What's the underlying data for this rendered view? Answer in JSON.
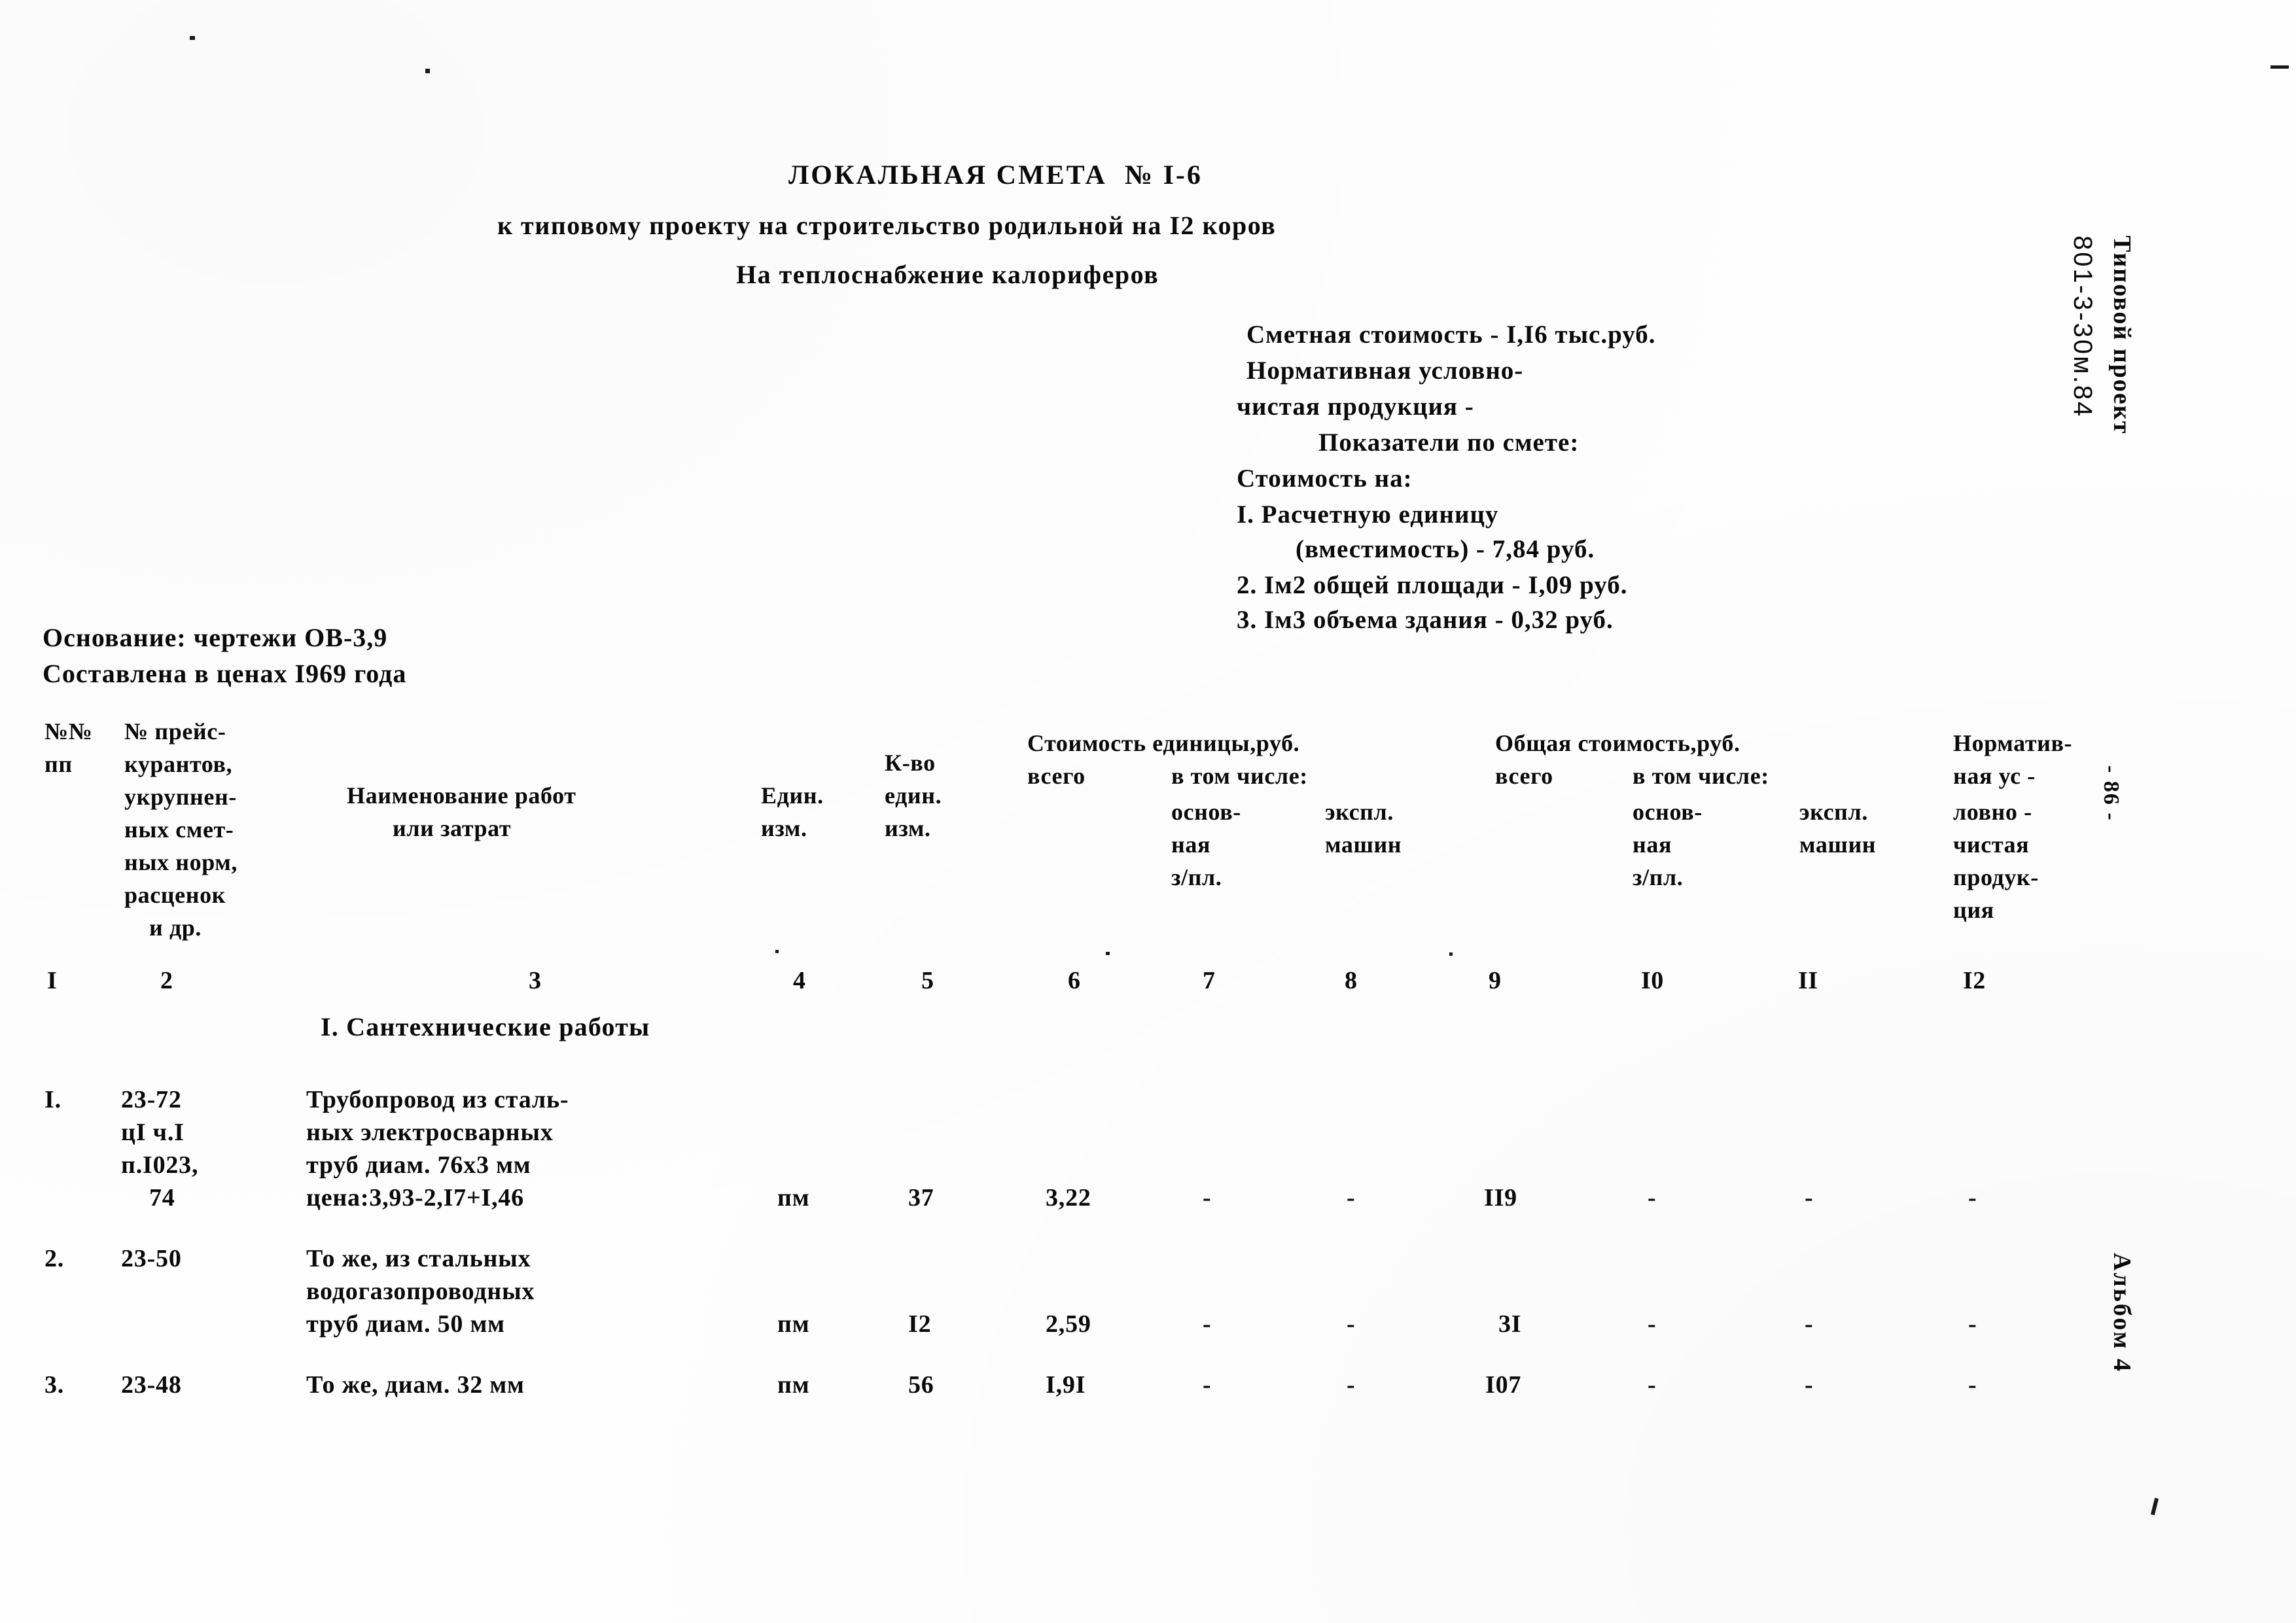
{
  "document": {
    "title": "ЛОКАЛЬНАЯ СМЕТА  № I-6",
    "subtitle_1": "к типовому проекту на строительство родильной на I2 коров",
    "subtitle_2": "На теплоснабжение калориферов"
  },
  "summary": {
    "lines": [
      "Сметная стоимость - I,I6 тыс.руб.",
      "Нормативная условно-",
      "чистая продукция -",
      "Показатели по смете:",
      "Стоимость на:",
      "I. Расчетную единицу",
      "(вместимость) - 7,84 руб.",
      "2. Iм2 общей площади - I,09 руб.",
      "3. Iм3 объема здания - 0,32 руб."
    ]
  },
  "basis": {
    "line_1": "Основание: чертежи ОВ-3,9",
    "line_2": "Составлена в ценах I969 года"
  },
  "table": {
    "header": {
      "col1": [
        "№№",
        "пп"
      ],
      "col2": [
        "№ прейс-",
        "курантов,",
        "укрупнен-",
        "ных смет-",
        "ных норм,",
        "расценок",
        "и др."
      ],
      "col3": [
        "Наименование работ",
        "или затрат"
      ],
      "col4": [
        "Един.",
        "изм."
      ],
      "col5": [
        "К-во",
        "един.",
        "изм."
      ],
      "group_unit_cost": "Стоимость единицы,руб.",
      "col6": [
        "всего"
      ],
      "sub_unit": "в том числе:",
      "col7": [
        "основ-",
        "ная",
        "з/пл."
      ],
      "col8": [
        "экспл.",
        "машин"
      ],
      "group_total_cost": "Общая стоимость,руб.",
      "col9": [
        "всего"
      ],
      "sub_total": "в том числе:",
      "col10": [
        "основ-",
        "ная",
        "з/пл."
      ],
      "col11": [
        "экспл.",
        "машин"
      ],
      "col12": [
        "Норматив-",
        "ная ус -",
        "ловно -",
        "чистая",
        "продук-",
        "ция"
      ]
    },
    "column_numbers": [
      "I",
      "2",
      "3",
      "4",
      "5",
      "6",
      "7",
      "8",
      "9",
      "I0",
      "II",
      "I2"
    ],
    "section_title": "I. Сантехнические работы",
    "rows": [
      {
        "no": "I.",
        "code": [
          "23-72",
          "цI ч.I",
          "п.I023,",
          "74"
        ],
        "name": [
          "Трубопровод из сталь-",
          "ных электросварных",
          "труб диам. 76х3 мм",
          "цена:3,93-2,I7+I,46"
        ],
        "unit": "пм",
        "qty": "37",
        "unit_total": "3,22",
        "unit_wage": "-",
        "unit_mach": "-",
        "total": "II9",
        "total_wage": "-",
        "total_mach": "-",
        "net_product": "-"
      },
      {
        "no": "2.",
        "code": [
          "23-50"
        ],
        "name": [
          "То же, из стальных",
          "водогазопроводных",
          "труб диам. 50 мм"
        ],
        "unit": "пм",
        "qty": "I2",
        "unit_total": "2,59",
        "unit_wage": "-",
        "unit_mach": "-",
        "total": "3I",
        "total_wage": "-",
        "total_mach": "-",
        "net_product": "-"
      },
      {
        "no": "3.",
        "code": [
          "23-48"
        ],
        "name": [
          "То же, диам. 32 мм"
        ],
        "unit": "пм",
        "qty": "56",
        "unit_total": "I,9I",
        "unit_wage": "-",
        "unit_mach": "-",
        "total": "I07",
        "total_wage": "-",
        "total_mach": "-",
        "net_product": "-"
      }
    ]
  },
  "margin": {
    "project_label": "Типовой проект",
    "project_code": "801-3-30м.84",
    "page_marker": "- 86 -",
    "album": "Альбом 4"
  }
}
